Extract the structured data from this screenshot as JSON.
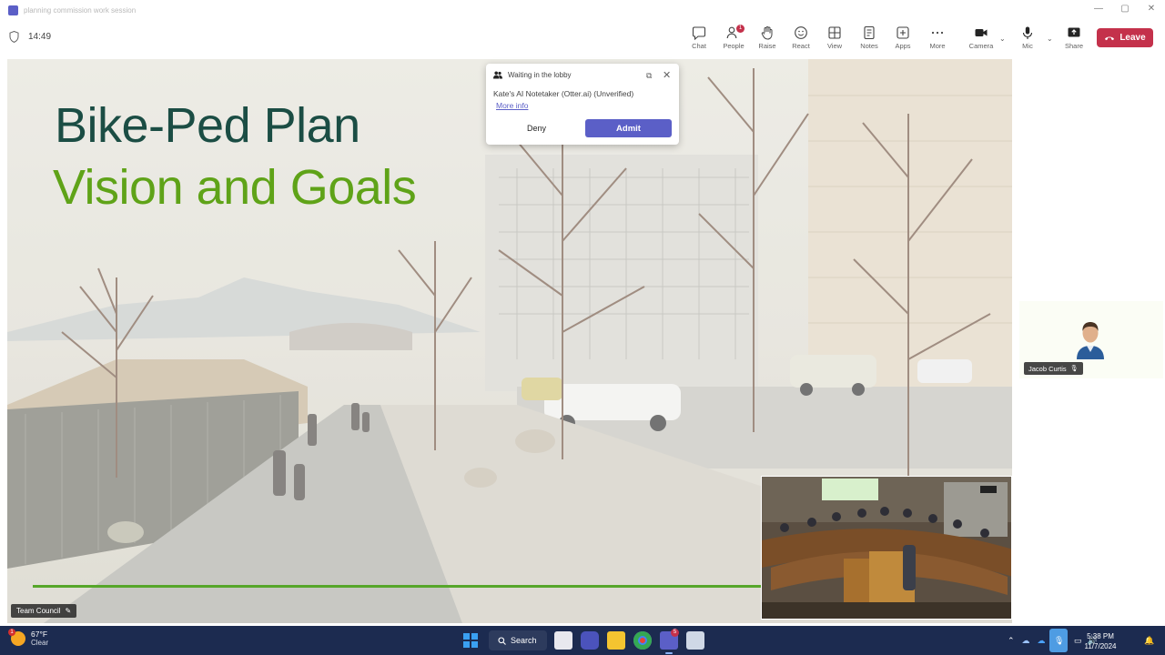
{
  "window": {
    "title": "planning commission work session",
    "controls": [
      "—",
      "▢",
      "✕"
    ]
  },
  "meeting": {
    "timer": "14:49"
  },
  "toolbar": {
    "chat": "Chat",
    "people": "People",
    "people_badge": "1",
    "raise": "Raise",
    "react": "React",
    "view": "View",
    "notes": "Notes",
    "apps": "Apps",
    "more": "More",
    "camera": "Camera",
    "mic": "Mic",
    "share": "Share",
    "leave": "Leave",
    "leave_color": "#c4314b"
  },
  "slide": {
    "title_line1": "Bike-Ped Plan",
    "title_line2": "Vision and Goals",
    "title1_color": "#1b4d44",
    "title2_color": "#5fa318"
  },
  "stage_label": "Team Council",
  "lobby": {
    "header": "Waiting in the lobby",
    "person": "Kate's AI Notetaker (Otter.ai) (Unverified)",
    "more_info": "More info",
    "deny": "Deny",
    "admit": "Admit",
    "accent": "#5b5fc7"
  },
  "participant": {
    "name": "Jacob Curtis"
  },
  "taskbar": {
    "weather_temp": "67°F",
    "weather_cond": "Clear",
    "weather_badge": "1",
    "search": "Search",
    "teams_badge": "5",
    "time": "5:38 PM",
    "date": "11/7/2024"
  }
}
